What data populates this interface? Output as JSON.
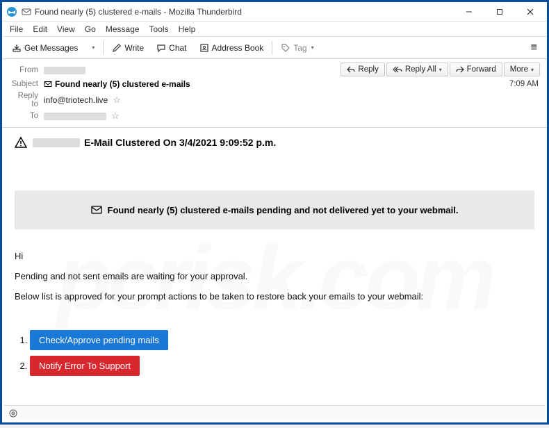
{
  "window": {
    "title": "Found nearly (5) clustered e-mails - Mozilla Thunderbird"
  },
  "menu": {
    "items": [
      "File",
      "Edit",
      "View",
      "Go",
      "Message",
      "Tools",
      "Help"
    ]
  },
  "toolbar": {
    "get_messages": "Get Messages",
    "write": "Write",
    "chat": "Chat",
    "address_book": "Address Book",
    "tag": "Tag"
  },
  "headers": {
    "labels": {
      "from": "From",
      "subject": "Subject",
      "reply_to": "Reply to",
      "to": "To"
    },
    "subject": "Found nearly (5) clustered e-mails",
    "reply_to_value": "info@triotech.live"
  },
  "actions": {
    "reply": "Reply",
    "reply_all": "Reply All",
    "forward": "Forward",
    "more": "More"
  },
  "meta": {
    "time": "7:09 AM"
  },
  "body": {
    "warning_text": "E-Mail Clustered On 3/4/2021 9:09:52 p.m.",
    "banner_text": "Found nearly (5) clustered e-mails pending and not delivered yet to your webmail.",
    "greeting": "Hi",
    "line1": "Pending and not sent emails are waiting for your approval.",
    "line2": "Below list is approved for your prompt actions to be taken to restore back your emails to your webmail:",
    "btn1": "Check/Approve pending mails",
    "btn2": "Notify Error To Support"
  },
  "watermark": "pcrisk.com"
}
